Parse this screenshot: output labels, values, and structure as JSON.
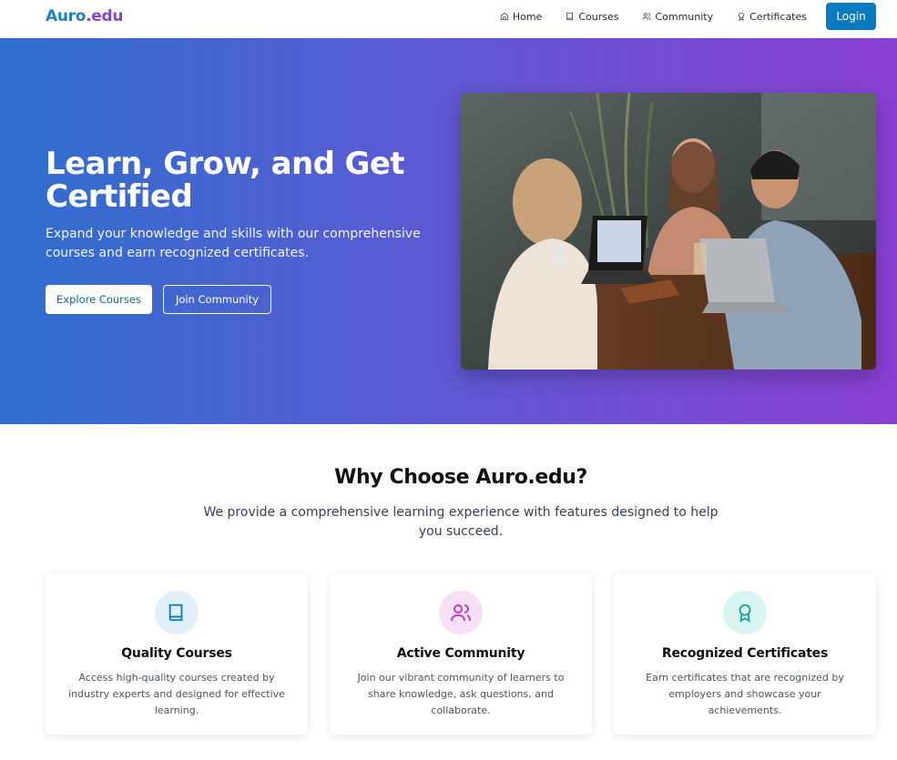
{
  "brand": {
    "part1": "Auro",
    "part2": ".edu"
  },
  "nav": {
    "items": [
      {
        "label": "Home",
        "icon": "home-icon"
      },
      {
        "label": "Courses",
        "icon": "book-icon"
      },
      {
        "label": "Community",
        "icon": "users-icon"
      },
      {
        "label": "Certificates",
        "icon": "award-icon"
      }
    ],
    "login": "Login"
  },
  "hero": {
    "title": "Learn, Grow, and Get Certified",
    "subtitle": "Expand your knowledge and skills with our comprehensive courses and earn recognized certificates.",
    "explore_button": "Explore Courses",
    "join_button": "Join Community",
    "image": "photo-of-three-students-laughing-at-table-with-laptops"
  },
  "features": {
    "title": "Why Choose Auro.edu?",
    "subtitle": "We provide a comprehensive learning experience with features designed to help you succeed.",
    "cards": [
      {
        "title": "Quality Courses",
        "description": "Access high-quality courses created by industry experts and designed for effective learning.",
        "icon": "book-icon",
        "color": "#0a7bc1"
      },
      {
        "title": "Active Community",
        "description": "Join our vibrant community of learners to share knowledge, ask questions, and collaborate.",
        "icon": "users-icon",
        "color": "#b93fc9"
      },
      {
        "title": "Recognized Certificates",
        "description": "Earn certificates that are recognized by employers and showcase your achievements.",
        "icon": "award-icon",
        "color": "#14a597"
      }
    ]
  },
  "colors": {
    "brand_blue": "#1f7fc1",
    "brand_purple": "#8b3fd1",
    "primary": "#0a7bc1",
    "hero_gradient_start": "#2e6fcd",
    "hero_gradient_end": "#8a3fd3"
  }
}
